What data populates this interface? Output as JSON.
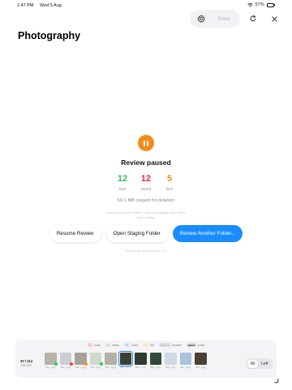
{
  "status": {
    "time": "1:47 PM",
    "date": "Wed 5 Aug",
    "battery": "57%",
    "battery_level": 0.57
  },
  "top_controls": {
    "done_label": "Done"
  },
  "page_title": "Photography",
  "review": {
    "title": "Review paused",
    "stats": [
      {
        "value": "12",
        "label": "kept",
        "color": "#2dbf5a"
      },
      {
        "value": "12",
        "label": "tossed",
        "color": "#e8293b"
      },
      {
        "value": "5",
        "label": "filed",
        "color": "#f28b19"
      }
    ],
    "staged": "69.1 MB staged for deletion",
    "note_line1": "Nothing has been deleted. Open the staging folder when",
    "note_line2": "you're ready."
  },
  "actions": {
    "resume": "Resume Review",
    "open_staging": "Open Staging Folder",
    "review_another": "Review Another Folder..."
  },
  "hint": "Pick any file below to return to it.",
  "legend": [
    {
      "key": "⇐",
      "label": "toss",
      "kind": "loss"
    },
    {
      "key": "⇒",
      "label": "keep",
      "kind": "keep"
    },
    {
      "key": "⇑",
      "label": "undo",
      "kind": "undo"
    },
    {
      "key": "↓",
      "label": "file",
      "kind": "file"
    },
    {
      "key": "⌥ ⇐ ⇒",
      "label": "browse",
      "kind": "browse"
    },
    {
      "key": "space",
      "label": "peek",
      "kind": "space"
    }
  ],
  "counter": {
    "position": "30 / 214",
    "left": "184 left"
  },
  "thumbnails": [
    {
      "caption": "IMG...3.jpg",
      "color": "#b9b3a5",
      "badge": "green"
    },
    {
      "caption": "IMG...2.jpg",
      "color": "#c9cfd4",
      "badge": "red"
    },
    {
      "caption": "IMG...1.jpg",
      "color": "#a8a39a",
      "badge": "orange"
    },
    {
      "caption": "IMG...0.jpg",
      "color": "#cfd9cf",
      "badge": "green"
    },
    {
      "caption": "IMG...9.jpg",
      "color": "#b5b0a6",
      "badge": ""
    },
    {
      "caption": "IMG...8.jpg",
      "color": "#3a3f36",
      "badge": "",
      "active": true
    },
    {
      "caption": "IMG...7.jpg",
      "color": "#2f3a30",
      "badge": ""
    },
    {
      "caption": "IMG...6.jpg",
      "color": "#314a37",
      "badge": ""
    },
    {
      "caption": "IMG...5.jpg",
      "color": "#cfd8e4",
      "badge": ""
    },
    {
      "caption": "IMG...4.jpg",
      "color": "#a9c2da",
      "badge": ""
    },
    {
      "caption": "IMG...3.jpg",
      "color": "#4b4036",
      "badge": ""
    }
  ],
  "segmented": {
    "all": "All",
    "left": "Left"
  }
}
